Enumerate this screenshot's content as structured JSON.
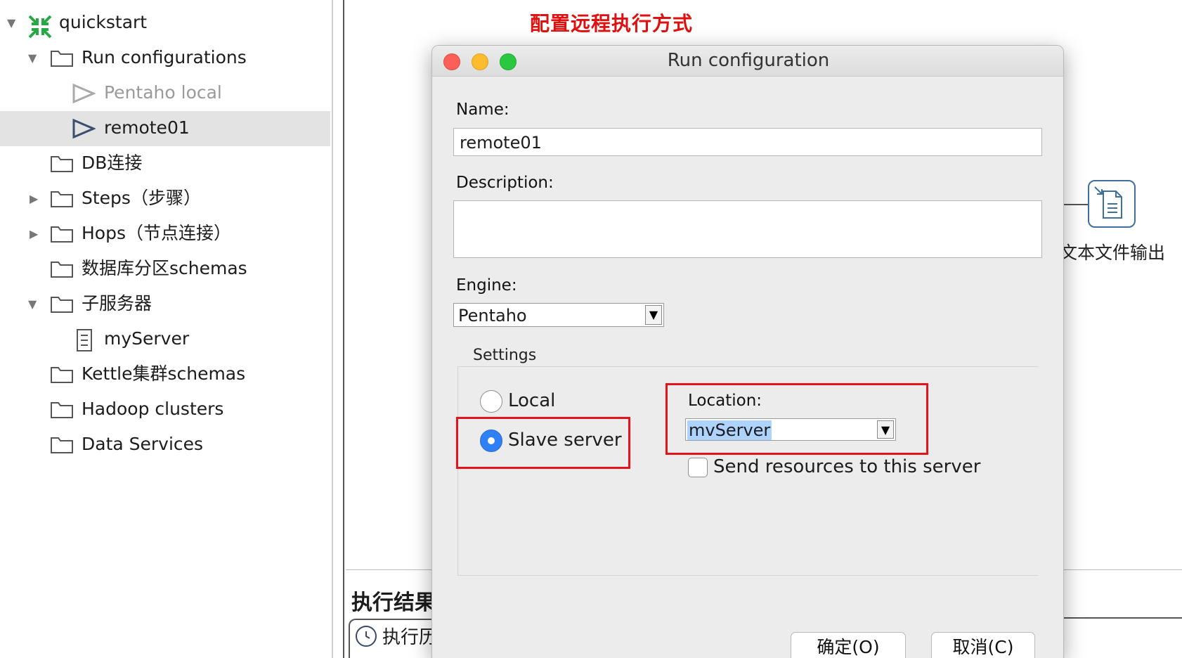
{
  "tree": {
    "root_label": "quickstart",
    "items": [
      {
        "label": "Run configurations"
      },
      {
        "label": "Pentaho local"
      },
      {
        "label": "remote01"
      },
      {
        "label": "DB连接"
      },
      {
        "label": "Steps（步骤）"
      },
      {
        "label": "Hops（节点连接）"
      },
      {
        "label": "数据库分区schemas"
      },
      {
        "label": "子服务器"
      },
      {
        "label": "myServer"
      },
      {
        "label": "Kettle集群schemas"
      },
      {
        "label": "Hadoop clusters"
      },
      {
        "label": "Data Services"
      }
    ],
    "selected": "remote01"
  },
  "canvas": {
    "annotation": "配置远程执行方式",
    "step_label": "文本文件输出",
    "exec_panel_title": "执行结果",
    "exec_tab_label": "执行历"
  },
  "dialog": {
    "title": "Run configuration",
    "name_label": "Name:",
    "name_value": "remote01",
    "description_label": "Description:",
    "description_value": "",
    "engine_label": "Engine:",
    "engine_value": "Pentaho",
    "settings_label": "Settings",
    "local_label": "Local",
    "slave_label": "Slave server",
    "selected_mode": "Slave server",
    "location_label": "Location:",
    "location_value": "mvServer",
    "send_resources_label": "Send resources to this server",
    "send_resources_checked": false,
    "ok_label": "确定(O)",
    "cancel_label": "取消(C)"
  },
  "colors": {
    "annotation_red": "#e5141b",
    "radio_selected": "#2f7ff5",
    "selection_highlight": "#aed3ff",
    "traffic_close": "#fc5f57",
    "traffic_min": "#fdbc2e",
    "traffic_max": "#29c840"
  },
  "icons": [
    "kettle-logo-icon",
    "folder-icon",
    "play-icon",
    "server-icon",
    "text-file-output-icon",
    "history-icon"
  ]
}
